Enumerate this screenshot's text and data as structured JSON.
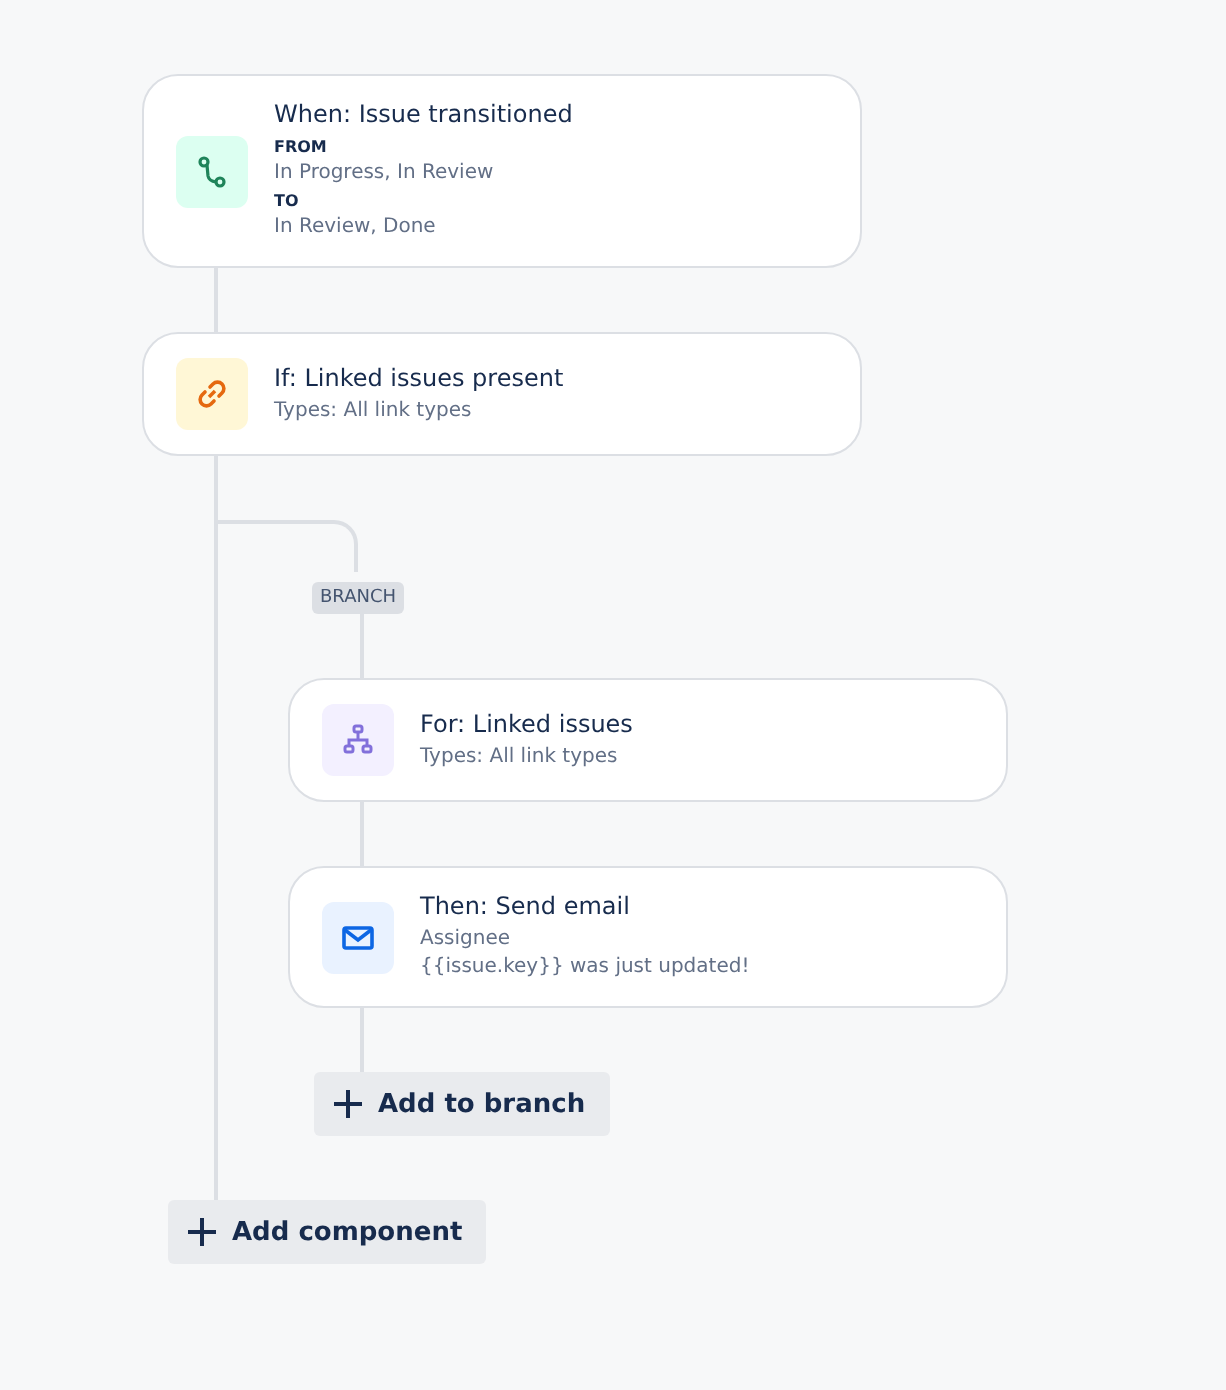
{
  "steps": [
    {
      "kind": "trigger",
      "title": "When: Issue transitioned",
      "details": [
        {
          "kind": "label",
          "text": "FROM"
        },
        {
          "kind": "value",
          "text": "In Progress, In Review"
        },
        {
          "kind": "label",
          "text": "TO"
        },
        {
          "kind": "value",
          "text": "In Review, Done"
        }
      ]
    },
    {
      "kind": "condition",
      "title": "If: Linked issues present",
      "details": [
        {
          "kind": "value",
          "text": "Types: All link types"
        }
      ]
    }
  ],
  "branch": {
    "badge": "BRANCH",
    "steps": [
      {
        "kind": "branch",
        "title": "For: Linked issues",
        "details": [
          {
            "kind": "value",
            "text": "Types: All link types"
          }
        ]
      },
      {
        "kind": "action",
        "title": "Then: Send email",
        "details": [
          {
            "kind": "value",
            "text": "Assignee"
          },
          {
            "kind": "value",
            "text": "{{issue.key}} was just updated!"
          }
        ]
      }
    ],
    "add_button": "Add to branch"
  },
  "add_button": "Add component"
}
